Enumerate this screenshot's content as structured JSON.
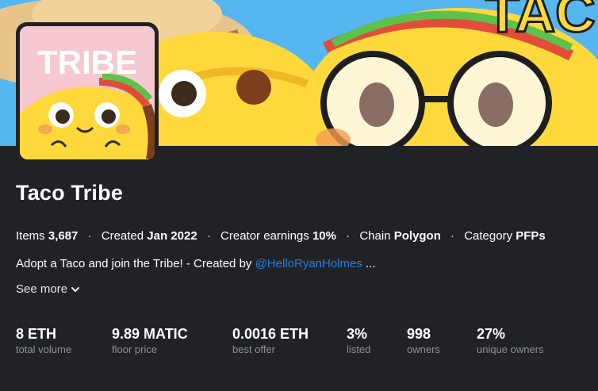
{
  "collection": {
    "name": "Taco Tribe",
    "avatar_text": "TRIBE"
  },
  "meta": {
    "items_label": "Items",
    "items_value": "3,687",
    "created_label": "Created",
    "created_value": "Jan 2022",
    "earnings_label": "Creator earnings",
    "earnings_value": "10%",
    "chain_label": "Chain",
    "chain_value": "Polygon",
    "category_label": "Category",
    "category_value": "PFPs",
    "separator": "·"
  },
  "description": {
    "text": "Adopt a Taco and join the Tribe! - Created by ",
    "link": "@HelloRyanHolmes",
    "ellipsis": " ..."
  },
  "see_more": {
    "label": "See more",
    "icon": "chevron-down-icon"
  },
  "stats": [
    {
      "value": "8 ETH",
      "label": "total volume"
    },
    {
      "value": "9.89 MATIC",
      "label": "floor price"
    },
    {
      "value": "0.0016 ETH",
      "label": "best offer"
    },
    {
      "value": "3%",
      "label": "listed"
    },
    {
      "value": "998",
      "label": "owners"
    },
    {
      "value": "27%",
      "label": "unique owners"
    }
  ],
  "colors": {
    "background": "#202225",
    "link": "#2081e2",
    "muted": "#8a939b",
    "taco_yellow": "#ffd93b",
    "banner_sky": "#56b7f0",
    "avatar_pink": "#f6c8cf"
  }
}
